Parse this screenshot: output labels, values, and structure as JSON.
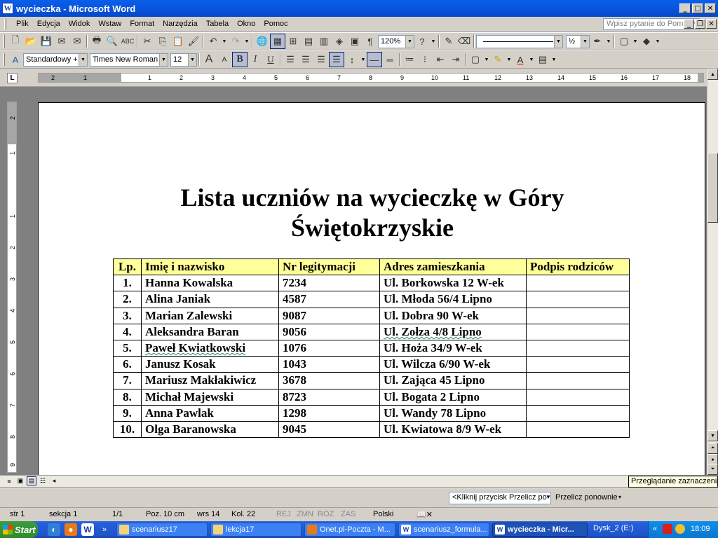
{
  "window": {
    "title": "wycieczka - Microsoft Word",
    "app_icon": "W"
  },
  "menu": {
    "items": [
      "Plik",
      "Edycja",
      "Widok",
      "Wstaw",
      "Format",
      "Narzędzia",
      "Tabela",
      "Okno",
      "Pomoc"
    ],
    "help_placeholder": "Wpisz pytanie do Pomocy"
  },
  "toolbar": {
    "zoom": "120%",
    "line_weight": "½"
  },
  "format_toolbar": {
    "style": "Standardowy +",
    "font": "Times New Roman",
    "size": "12"
  },
  "ruler": {
    "h_ticks": [
      "2",
      "1",
      "1",
      "2",
      "3",
      "4",
      "5",
      "6",
      "7",
      "8",
      "9",
      "10",
      "11",
      "12",
      "13",
      "14",
      "15",
      "16",
      "17",
      "18"
    ],
    "v_ticks": [
      "2",
      "1",
      "1",
      "2",
      "3",
      "4",
      "5",
      "6",
      "7",
      "8",
      "9"
    ],
    "tab_selector": "L"
  },
  "document": {
    "title_line1": "Lista uczniów na wycieczkę w Góry",
    "title_line2": "Świętokrzyskie",
    "table": {
      "headers": [
        "Lp.",
        "Imię i nazwisko",
        "Nr legitymacji",
        "Adres zamieszkania",
        "Podpis rodziców"
      ],
      "rows": [
        [
          "1.",
          "Hanna Kowalska",
          "7234",
          "Ul. Borkowska 12 W-ek",
          ""
        ],
        [
          "2.",
          "Alina Janiak",
          "4587",
          "Ul. Młoda 56/4 Lipno",
          ""
        ],
        [
          "3.",
          "Marian Zalewski",
          "9087",
          "Ul. Dobra 90 W-ek",
          ""
        ],
        [
          "4.",
          "Aleksandra Baran",
          "9056",
          "Ul. Zołza 4/8 Lipno",
          ""
        ],
        [
          "5.",
          "Paweł Kwiatkowski",
          "1076",
          "Ul. Hoża 34/9 W-ek",
          ""
        ],
        [
          "6.",
          "Janusz Kosak",
          "1043",
          "Ul. Wilcza 6/90 W-ek",
          ""
        ],
        [
          "7.",
          "Mariusz Makłakiwicz",
          "3678",
          "Ul. Zająca 45 Lipno",
          ""
        ],
        [
          "8.",
          "Michał Majewski",
          "8723",
          "Ul. Bogata 2 Lipno",
          ""
        ],
        [
          "9.",
          "Anna Pawlak",
          "1298",
          "Ul. Wandy 78 Lipno",
          ""
        ],
        [
          "10.",
          "Olga Baranowska",
          "9045",
          "Ul. Kwiatowa 8/9 W-ek",
          ""
        ]
      ]
    },
    "header_bg": "#ffff99"
  },
  "tooltip": "Przeglądanie zaznaczenia",
  "przelicz": {
    "combo": "<Kliknij przycisk Przelicz po",
    "button": "Przelicz ponownie"
  },
  "status": {
    "page": "str  1",
    "section": "sekcja  1",
    "pages": "1/1",
    "pos": "Poz.  10 cm",
    "line": "wrs  14",
    "col": "Kol.  22",
    "rej": "REJ",
    "zmn": "ZMN",
    "roz": "ROZ",
    "zas": "ZAS",
    "lang": "Polski"
  },
  "taskbar": {
    "start": "Start",
    "tasks": [
      {
        "label": "scenariusz17",
        "icon": "folder-icon"
      },
      {
        "label": "lekcja17",
        "icon": "folder-icon"
      },
      {
        "label": "Onet.pl-Poczta - M...",
        "icon": "firefox-icon"
      },
      {
        "label": "scenariusz_formula...",
        "icon": "word-icon"
      },
      {
        "label": "wycieczka - Micr...",
        "icon": "word-icon",
        "active": true
      }
    ],
    "disk": "Dysk_2 (E:)",
    "clock": "18:09"
  },
  "colors": {
    "titlebar": "#0a5ee8",
    "taskbar": "#245edb",
    "start": "#3c9c3c"
  }
}
